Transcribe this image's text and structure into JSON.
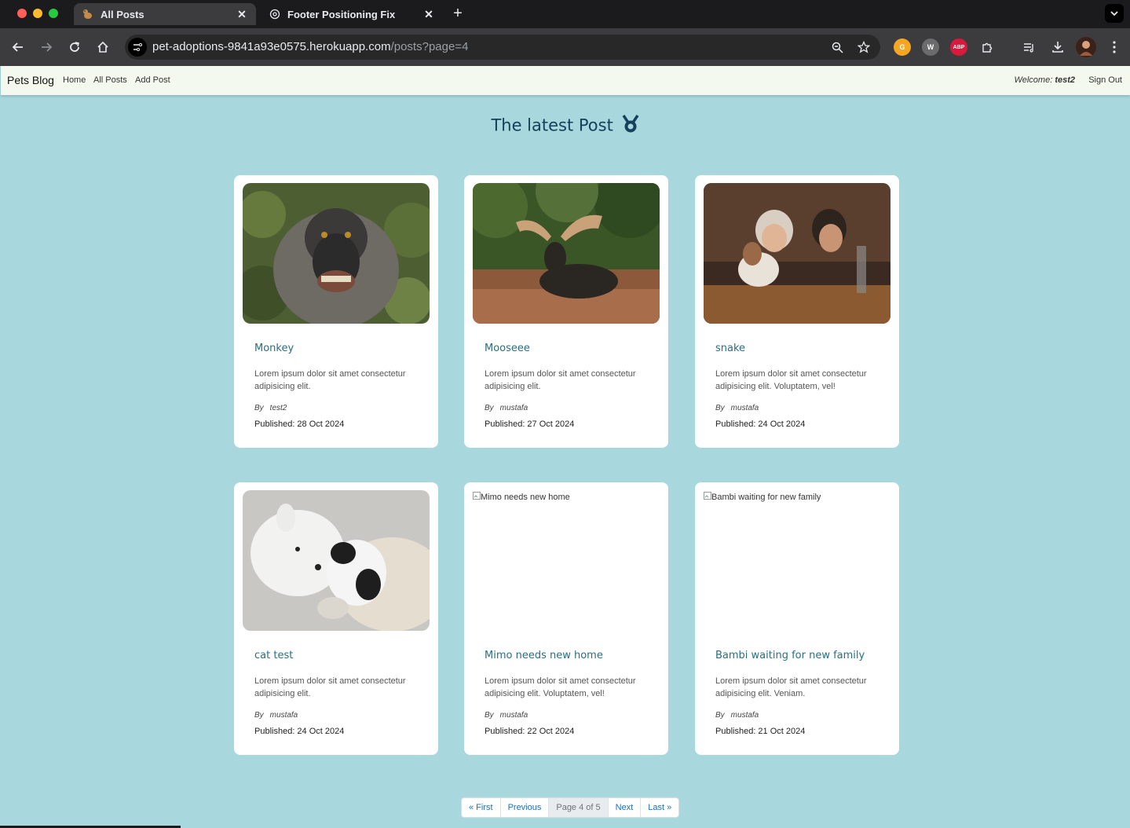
{
  "browser": {
    "tabs": [
      {
        "title": "All Posts",
        "favicon": "dog-icon",
        "active": true
      },
      {
        "title": "Footer Positioning Fix",
        "favicon": "openai-icon",
        "active": false
      }
    ],
    "url_host": "pet-adoptions-9841a93e0575.herokuapp.com",
    "url_path": "/posts?page=4",
    "extensions": [
      {
        "name": "grammarly-extension",
        "color": "#f5a623",
        "label": "G"
      },
      {
        "name": "wakatime-extension",
        "color": "#6b6b6b",
        "label": "W"
      },
      {
        "name": "adblock-plus-extension",
        "color": "#d81b3c",
        "label": "ABP"
      }
    ]
  },
  "navbar": {
    "brand": "Pets Blog",
    "links": [
      "Home",
      "All Posts",
      "Add Post"
    ],
    "welcome_label": "Welcome:",
    "welcome_user": "test2",
    "signout": "Sign Out"
  },
  "heading": "The latest Post",
  "posts": [
    {
      "title": "Monkey",
      "desc": "Lorem ipsum dolor sit amet consectetur adipisicing elit.",
      "by": "By",
      "author": "test2",
      "published": "Published: 28 Oct 2024",
      "image": "monkey-photo"
    },
    {
      "title": "Mooseee",
      "desc": "Lorem ipsum dolor sit amet consectetur adipisicing elit.",
      "by": "By",
      "author": "mustafa",
      "published": "Published: 27 Oct 2024",
      "image": "moose-photo"
    },
    {
      "title": "snake",
      "desc": "Lorem ipsum dolor sit amet consectetur adipisicing elit. Voluptatem, vel!",
      "by": "By",
      "author": "mustafa",
      "published": "Published: 24 Oct 2024",
      "image": "people-dog-photo"
    },
    {
      "title": "cat test",
      "desc": "Lorem ipsum dolor sit amet consectetur adipisicing elit.",
      "by": "By",
      "author": "mustafa",
      "published": "Published: 24 Oct 2024",
      "image": "dog-cat-photo"
    },
    {
      "title": "Mimo needs new home",
      "desc": "Lorem ipsum dolor sit amet consectetur adipisicing elit. Voluptatem, vel!",
      "by": "By",
      "author": "mustafa",
      "published": "Published: 22 Oct 2024",
      "image_alt": "Mimo needs new home"
    },
    {
      "title": "Bambi waiting for new family",
      "desc": "Lorem ipsum dolor sit amet consectetur adipisicing elit. Veniam.",
      "by": "By",
      "author": "mustafa",
      "published": "Published: 21 Oct 2024",
      "image_alt": "Bambi waiting for new family"
    }
  ],
  "pagination": {
    "first": "« First",
    "previous": "Previous",
    "current": "Page 4 of 5",
    "next": "Next",
    "last": "Last »"
  }
}
